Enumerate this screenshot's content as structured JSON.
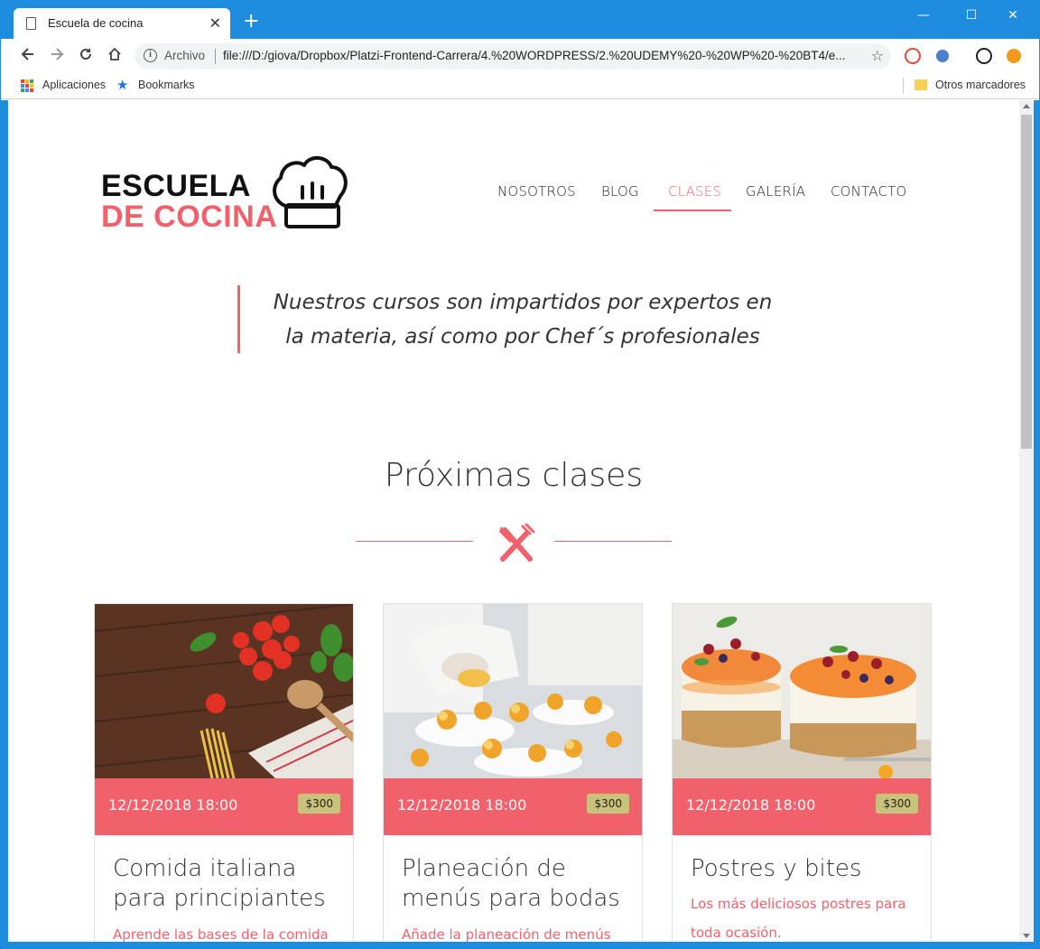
{
  "browser": {
    "tab_title": "Escuela de cocina",
    "tab_close": "✕",
    "new_tab": "+",
    "scheme_label": "Archivo",
    "url": "file:///D:/giova/Dropbox/Platzi-Frontend-Carrera/4.%20WORDPRESS/2.%20UDEMY%20-%20WP%20-%20BT4/e...",
    "window_controls": {
      "minimize": "—",
      "maximize": "☐",
      "close": "✕"
    },
    "bookmarks": {
      "apps": "Aplicaciones",
      "bookmarks": "Bookmarks",
      "other": "Otros marcadores"
    }
  },
  "site": {
    "logo": {
      "line1": "ESCUELA",
      "line2": "DE COCINA"
    },
    "nav": [
      {
        "label": "NOSOTROS"
      },
      {
        "label": "BLOG"
      },
      {
        "label": "CLASES",
        "active": true
      },
      {
        "label": "GALERÍA"
      },
      {
        "label": "CONTACTO"
      }
    ],
    "quote": "Nuestros cursos son impartidos por expertos en la materia, así como por Chef´s profesionales",
    "section_title": "Próximas clases",
    "accent_color": "#f0616b",
    "cards": [
      {
        "date": "12/12/2018 18:00",
        "price": "$300",
        "title": "Comida italiana para principiantes",
        "description": "Aprende las bases de la comida",
        "image": "pasta-tomatoes-image"
      },
      {
        "date": "12/12/2018 18:00",
        "price": "$300",
        "title": "Planeación de menús para bodas",
        "description": "Añade la planeación de menús",
        "image": "chef-plating-image"
      },
      {
        "date": "12/12/2018 18:00",
        "price": "$300",
        "title": "Postres y bites",
        "description": "Los más deliciosos postres para toda ocasión.",
        "image": "cheesecake-image"
      }
    ]
  }
}
